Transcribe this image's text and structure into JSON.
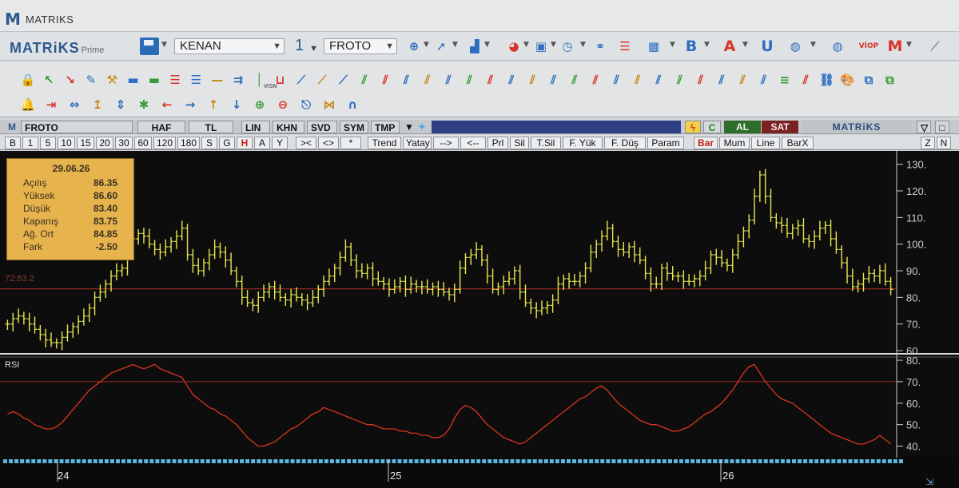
{
  "window": {
    "title": "MATRIKS",
    "app_icon": "M"
  },
  "toolbar1": {
    "logo": "MATRiKS",
    "logo_sub": "Prime",
    "user_combo": "KENAN",
    "layout_number": "1",
    "symbol_combo": "FROTO",
    "icons": [
      "search-icon",
      "cursor-icon",
      "bar-chart-icon",
      "pie-chart-icon",
      "monitor-icon",
      "clock-icon",
      "handshake-icon",
      "list-icon",
      "news-icon",
      "bold-b-icon",
      "font-a-icon",
      "underline-u-icon",
      "globe-icon",
      "globe2-icon",
      "viop-icon",
      "matriks-m-icon",
      "line-chart-icon"
    ],
    "letters": {
      "bold": "B",
      "font": "A",
      "underline": "U",
      "viop": "VİOP"
    }
  },
  "drawing_tools": {
    "row1": [
      "lock-icon",
      "arrow-up-left-icon",
      "arrow-down-right-icon",
      "edit-icon",
      "tools-icon",
      "ruler-icon",
      "ruler2-icon",
      "hlines-icon",
      "hlines2-icon",
      "hline-icon",
      "vision-icon",
      "vline-icon",
      "channel-icon",
      "trend1-icon",
      "trend2-icon",
      "trend3-icon",
      "fib1-icon",
      "fib2-icon",
      "fib3-icon",
      "fib4-icon",
      "fib5-icon",
      "fib6-icon",
      "fib7-icon",
      "fib8-icon",
      "fib9-icon",
      "fib10-icon",
      "fib11-icon",
      "fib12-icon",
      "fib13-icon",
      "fib14-icon",
      "fib15-icon",
      "fib16-icon",
      "fib17-icon",
      "fib18-icon",
      "fib19-icon",
      "fib20-icon",
      "fib21-icon",
      "parallel-icon",
      "link-icon",
      "paint-icon",
      "copy-icon",
      "copy2-icon"
    ],
    "row2": [
      "bell-icon",
      "shrink-h-icon",
      "expand-h-icon",
      "shrink-v-icon",
      "expand-v-icon",
      "asterisk-icon",
      "arrow-left-icon",
      "arrow-right-icon",
      "arrow-up-icon",
      "arrow-down-icon",
      "zoom-in-icon",
      "zoom-out-icon",
      "exit-icon",
      "bowtie-icon",
      "magnet-icon"
    ],
    "vision_label": "VISN"
  },
  "chart_header": {
    "icon": "M",
    "symbol": "FROTO",
    "period": "HAF",
    "currency": "TL",
    "buttons": [
      "LIN",
      "KHN",
      "SVD",
      "SYM",
      "TMP"
    ],
    "al": "AL",
    "sat": "SAT",
    "brand": "MATRiKS",
    "c_label": "C"
  },
  "period_bar": {
    "periods": [
      "B",
      "1",
      "5",
      "10",
      "15",
      "20",
      "30",
      "60",
      "120",
      "180",
      "S",
      "G",
      "H",
      "A",
      "Y"
    ],
    "active": "H",
    "nav": [
      "><",
      "<>",
      "*"
    ],
    "tools": [
      "Trend",
      "Yatay",
      "-->",
      "<--",
      "Prl",
      "Sil",
      "T.Sil",
      "F. Yük",
      "F. Düş",
      "Param"
    ],
    "chart_types": [
      "Bar",
      "Mum",
      "Line",
      "BarX"
    ],
    "active_type": "Bar",
    "extra": [
      "Z",
      "N"
    ]
  },
  "info_box": {
    "date": "29.06.26",
    "rows": [
      {
        "label": "Açılış",
        "value": "86.35"
      },
      {
        "label": "Yüksek",
        "value": "86.60"
      },
      {
        "label": "Düşük",
        "value": "83.40"
      },
      {
        "label": "Kapanış",
        "value": "83.75"
      },
      {
        "label": "Ağ. Ort",
        "value": "84.85"
      },
      {
        "label": "Fark",
        "value": "-2.50"
      }
    ]
  },
  "last_line_label": "72:83.2",
  "rsi_label": "RSI",
  "date_labels": [
    "24",
    "25",
    "26"
  ],
  "colors": {
    "background": "#0d0d0d",
    "bars": "#e8e650",
    "rsi": "#d9351c",
    "ref_line": "#a32b22",
    "axis": "#cfcfcf",
    "al": "#2f6d2c",
    "sat": "#7a2222",
    "info_box": "#e7b34d"
  },
  "chart_data": [
    {
      "type": "bar",
      "title": "",
      "ylabel": "",
      "ylim": [
        60,
        132
      ],
      "yticks": [
        60,
        70,
        80,
        90,
        100,
        110,
        120,
        130
      ],
      "reference_line": 83.2,
      "grid": false,
      "close": [
        70,
        72,
        73,
        72,
        70,
        68,
        66,
        64,
        63,
        63,
        65,
        67,
        69,
        71,
        73,
        76,
        80,
        82,
        85,
        88,
        90,
        91,
        97,
        102,
        104,
        103,
        100,
        98,
        97,
        99,
        101,
        103,
        106,
        96,
        92,
        90,
        93,
        96,
        99,
        97,
        94,
        90,
        86,
        80,
        78,
        77,
        80,
        82,
        84,
        82,
        80,
        79,
        81,
        80,
        79,
        78,
        80,
        83,
        86,
        88,
        91,
        95,
        99,
        94,
        90,
        89,
        91,
        87,
        86,
        85,
        83,
        84,
        86,
        83,
        85,
        84,
        84,
        83,
        84,
        83,
        82,
        81,
        83,
        91,
        95,
        96,
        98,
        94,
        88,
        83,
        84,
        86,
        87,
        90,
        82,
        78,
        76,
        75,
        76,
        77,
        79,
        85,
        87,
        86,
        86,
        88,
        91,
        97,
        100,
        103,
        106,
        101,
        98,
        97,
        99,
        96,
        94,
        89,
        85,
        85,
        91,
        89,
        88,
        88,
        86,
        86,
        87,
        88,
        91,
        96,
        95,
        93,
        92,
        96,
        101,
        105,
        109,
        118,
        126,
        118,
        110,
        108,
        107,
        104,
        106,
        107,
        102,
        101,
        103,
        106,
        107,
        102,
        98,
        93,
        88,
        84,
        85,
        87,
        89,
        88,
        90,
        86,
        83
      ],
      "bar_count": 163
    },
    {
      "type": "line",
      "title": "RSI",
      "ylim": [
        35,
        80
      ],
      "yticks": [
        40,
        50,
        60,
        70,
        80
      ],
      "reference_line": 70,
      "values": [
        55,
        56,
        55,
        53,
        52,
        50,
        49,
        48,
        48,
        49,
        51,
        54,
        57,
        60,
        63,
        66,
        68,
        70,
        72,
        74,
        75,
        76,
        77,
        78,
        77,
        76,
        77,
        78,
        76,
        75,
        74,
        73,
        72,
        68,
        64,
        62,
        60,
        58,
        57,
        55,
        54,
        52,
        50,
        47,
        44,
        42,
        40,
        40,
        41,
        42,
        44,
        46,
        48,
        49,
        51,
        53,
        55,
        56,
        58,
        57,
        56,
        55,
        54,
        53,
        52,
        51,
        50,
        50,
        49,
        48,
        48,
        48,
        47,
        47,
        46,
        46,
        45,
        45,
        44,
        44,
        45,
        48,
        53,
        57,
        59,
        58,
        56,
        53,
        50,
        48,
        46,
        44,
        43,
        42,
        41,
        42,
        44,
        46,
        48,
        50,
        52,
        54,
        56,
        58,
        60,
        62,
        63,
        65,
        67,
        68,
        66,
        63,
        60,
        58,
        56,
        54,
        52,
        51,
        50,
        50,
        49,
        48,
        47,
        47,
        48,
        49,
        51,
        53,
        55,
        56,
        58,
        60,
        63,
        66,
        70,
        74,
        77,
        78,
        74,
        70,
        67,
        64,
        62,
        61,
        60,
        58,
        56,
        54,
        52,
        50,
        48,
        46,
        45,
        44,
        43,
        42,
        41,
        41,
        42,
        43,
        45,
        43,
        41
      ]
    }
  ]
}
